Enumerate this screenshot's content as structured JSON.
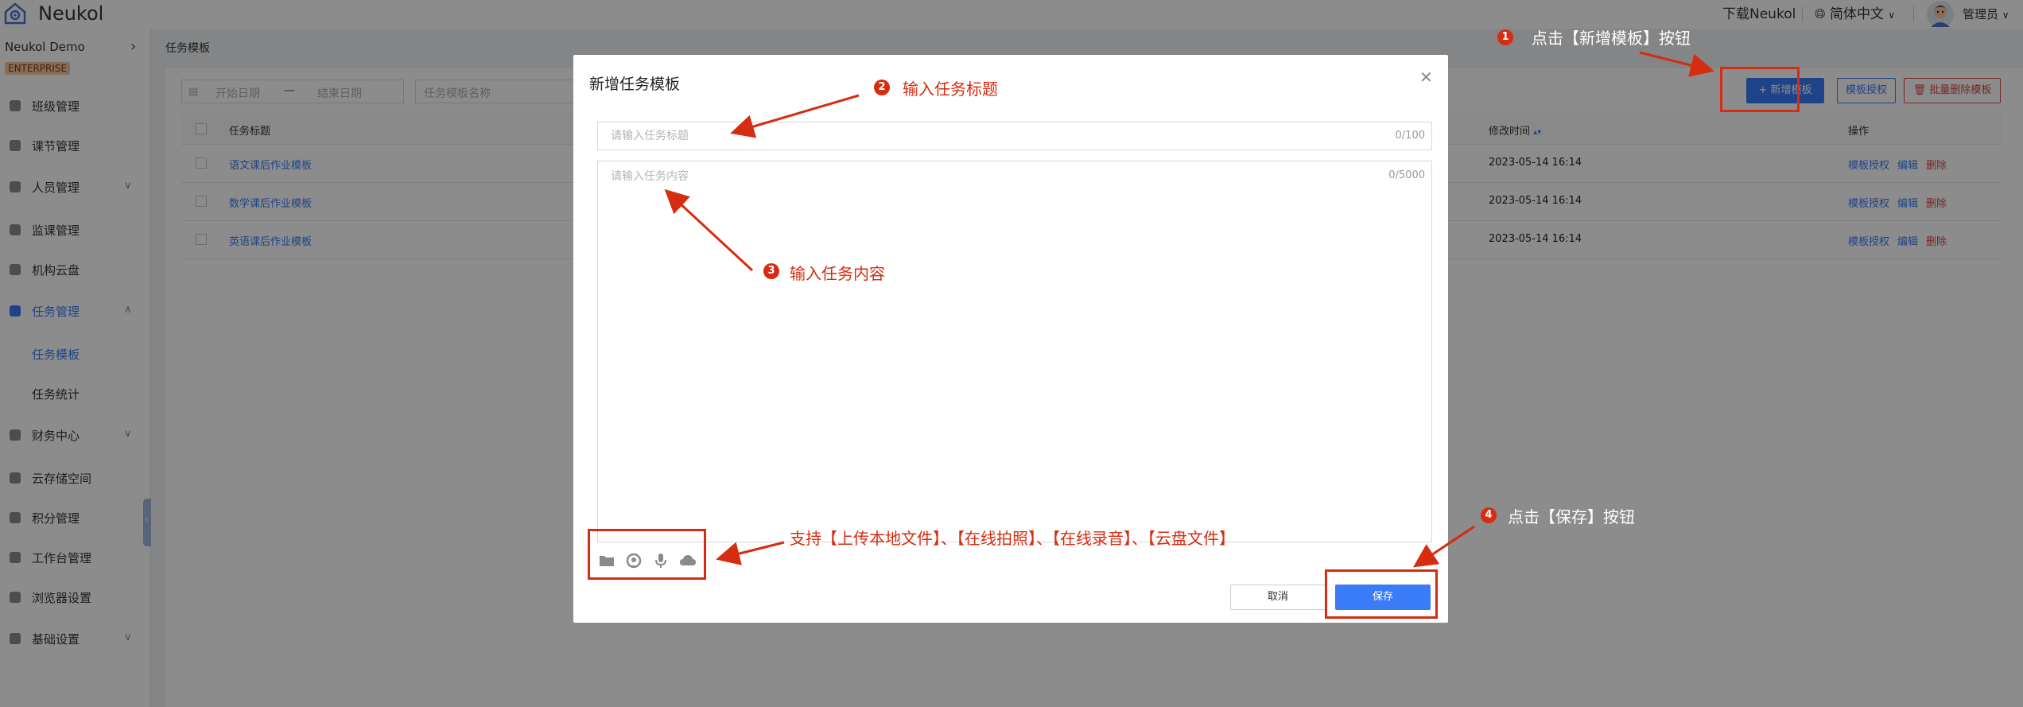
{
  "app": {
    "logo_text": "Neukol",
    "download_link": "下载Neukol",
    "language": "简体中文",
    "user_name": "管理员"
  },
  "sidebar": {
    "org_name": "Neukol Demo",
    "edition_badge": "ENTERPRISE",
    "items": [
      {
        "label": "班级管理"
      },
      {
        "label": "课节管理"
      },
      {
        "label": "人员管理"
      },
      {
        "label": "监课管理"
      },
      {
        "label": "机构云盘"
      },
      {
        "label": "任务管理"
      },
      {
        "label": "任务模板"
      },
      {
        "label": "任务统计"
      },
      {
        "label": "财务中心"
      },
      {
        "label": "云存储空间"
      },
      {
        "label": "积分管理"
      },
      {
        "label": "工作台管理"
      },
      {
        "label": "浏览器设置"
      },
      {
        "label": "基础设置"
      }
    ]
  },
  "page": {
    "breadcrumb": "任务模板",
    "filter": {
      "start_date_placeholder": "开始日期",
      "date_separator": "—",
      "end_date_placeholder": "结束日期",
      "name_placeholder": "任务模板名称"
    },
    "toolbar": {
      "add_template": "+ 新增模板",
      "template_auth": "模板授权",
      "batch_delete": "批量删除模板"
    },
    "table": {
      "columns": [
        "任务标题",
        "修改时间",
        "操作"
      ],
      "rows": [
        {
          "title": "语文课后作业模板",
          "modified": "2023-05-14 16:14"
        },
        {
          "title": "数学课后作业模板",
          "modified": "2023-05-14 16:14"
        },
        {
          "title": "英语课后作业模板",
          "modified": "2023-05-14 16:14"
        }
      ],
      "actions": {
        "auth": "模板授权",
        "edit": "编辑",
        "delete": "删除"
      }
    }
  },
  "modal": {
    "title": "新增任务模板",
    "title_placeholder": "请输入任务标题",
    "title_counter": "0/100",
    "content_placeholder": "请输入任务内容",
    "content_counter": "0/5000",
    "tools": [
      "folder-icon",
      "camera-icon",
      "microphone-icon",
      "cloud-icon"
    ],
    "cancel_label": "取消",
    "save_label": "保存"
  },
  "annotations": {
    "step1": {
      "num": "1",
      "text": "点击【新增模板】按钮"
    },
    "step2": {
      "num": "2",
      "text": "输入任务标题"
    },
    "step3": {
      "num": "3",
      "text": "输入任务内容"
    },
    "step4": {
      "num": "4",
      "text": "点击【保存】按钮"
    },
    "tools_note": "支持【上传本地文件】、【在线拍照】、【在线录音】、【云盘文件】",
    "color": "#d62c0f"
  }
}
